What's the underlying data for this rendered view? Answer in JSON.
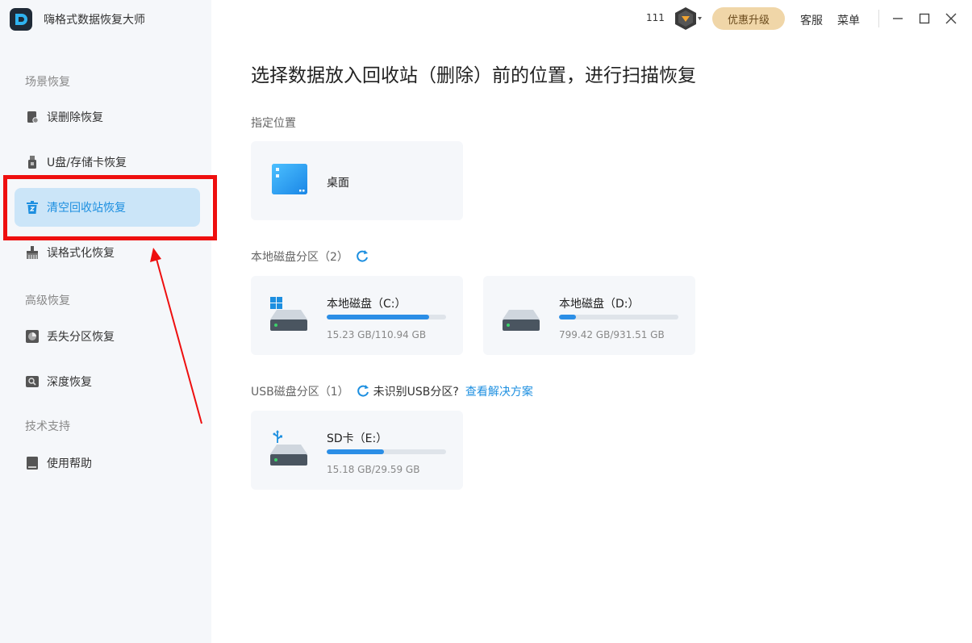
{
  "app": {
    "name": "嗨格式数据恢复大师"
  },
  "sidebar": {
    "sections": [
      {
        "title": "场景恢复"
      },
      {
        "title": "高级恢复"
      },
      {
        "title": "技术支持"
      }
    ],
    "items": [
      {
        "label": "误删除恢复"
      },
      {
        "label": "U盘/存储卡恢复"
      },
      {
        "label": "清空回收站恢复",
        "active": true
      },
      {
        "label": "误格式化恢复"
      },
      {
        "label": "丢失分区恢复"
      },
      {
        "label": "深度恢复"
      },
      {
        "label": "使用帮助"
      }
    ]
  },
  "topbar": {
    "count": "111",
    "upgrade_label": "优惠升级",
    "service_label": "客服",
    "menu_label": "菜单"
  },
  "main": {
    "title": "选择数据放入回收站（删除）前的位置，进行扫描恢复",
    "specified_label": "指定位置",
    "desktop": {
      "name": "桌面"
    },
    "local_label": "本地磁盘分区（2）",
    "local_disks": [
      {
        "name": "本地磁盘（C:）",
        "size": "15.23 GB/110.94 GB",
        "used_fraction": 0.86
      },
      {
        "name": "本地磁盘（D:）",
        "size": "799.42 GB/931.51 GB",
        "used_fraction": 0.14
      }
    ],
    "usb_label": "USB磁盘分区（1）",
    "usb_unrecognized": "未识别USB分区?",
    "usb_solution": "查看解决方案",
    "usb_disks": [
      {
        "name": "SD卡（E:）",
        "size": "15.18 GB/29.59 GB",
        "used_fraction": 0.48
      }
    ]
  },
  "colors": {
    "accent": "#1d8fe0",
    "active_bg": "#cbe5f8",
    "annotation": "#ee0f0f",
    "upgrade_bg": "#f0d6a8"
  }
}
